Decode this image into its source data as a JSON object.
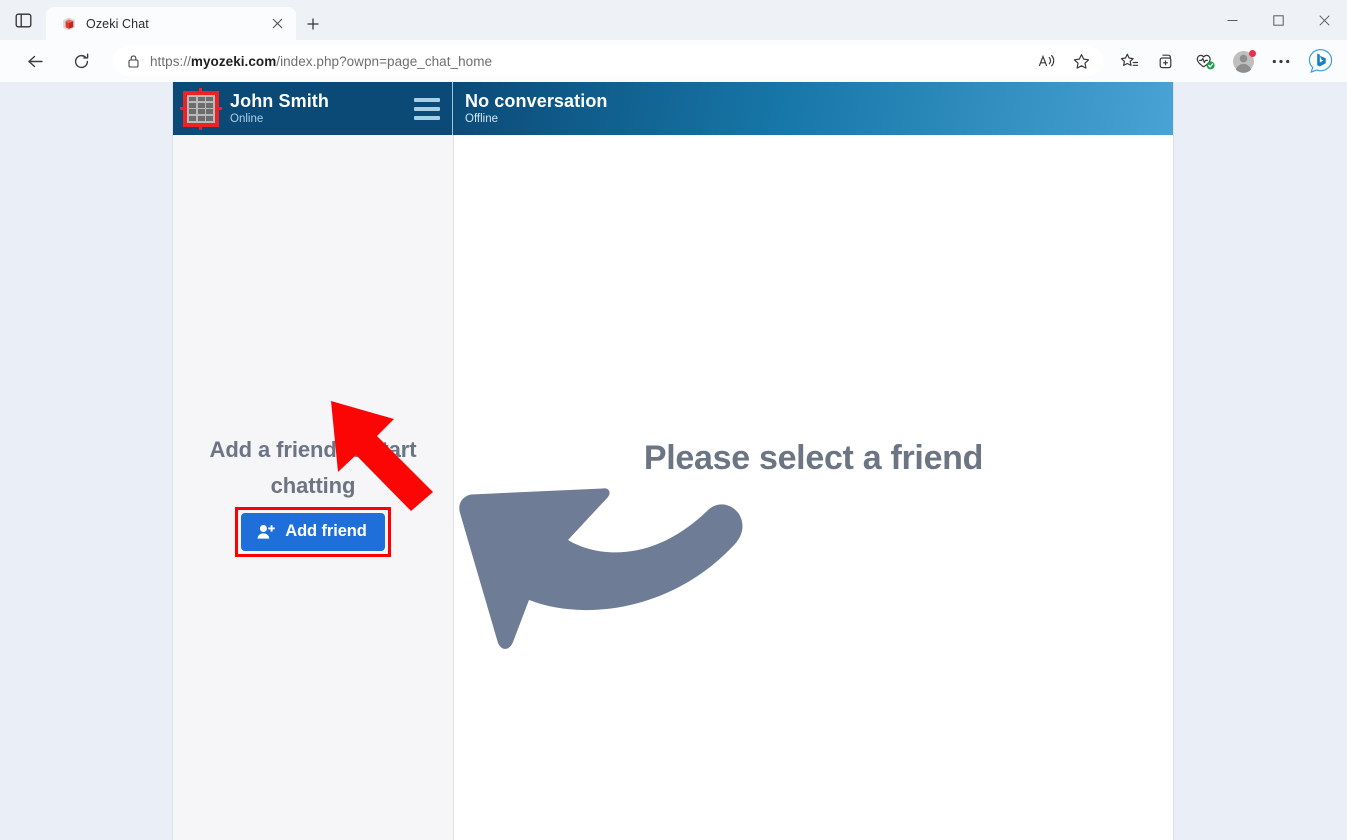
{
  "browser": {
    "tab": {
      "title": "Ozeki Chat",
      "favicon_icon": "red-cube-icon",
      "close_icon": "close-icon"
    },
    "new_tab_icon": "plus-icon",
    "tab_search_icon": "tab-list-icon",
    "window_controls": {
      "minimize_icon": "minimize-icon",
      "maximize_icon": "maximize-icon",
      "close_icon": "window-close-icon"
    },
    "nav": {
      "back_icon": "back-arrow-icon",
      "reload_icon": "reload-icon"
    },
    "address_bar": {
      "lock_icon": "lock-icon",
      "url_scheme": "https://",
      "url_domain": "myozeki.com",
      "url_path": "/index.php?owpn=page_chat_home",
      "read_aloud_icon": "read-aloud-icon",
      "favorite_icon": "star-icon"
    },
    "toolbar_icons": [
      "favorites-icon",
      "collections-icon",
      "browser-essentials-icon",
      "profile-icon",
      "settings-more-icon",
      "copilot-bing-icon"
    ]
  },
  "app": {
    "header": {
      "avatar_icon": "pixel-grid-avatar-icon",
      "user_name": "John Smith",
      "user_status": "Online",
      "menu_icon": "hamburger-menu-icon",
      "conversation_title": "No conversation",
      "conversation_status": "Offline"
    },
    "sidebar": {
      "empty_title": "Add a friend to start chatting",
      "add_friend_label": "Add friend",
      "add_friend_icon": "person-add-icon",
      "highlight_color": "#ff0000",
      "pointer_icon": "red-arrow-up-left-icon"
    },
    "main": {
      "placeholder_title": "Please select a friend",
      "pointer_icon": "gray-curved-arrow-left-icon"
    },
    "colors": {
      "header_dark": "#0b4a77",
      "header_light": "#49a3d4",
      "accent_button": "#1e6fd9",
      "muted_text": "#6c7583",
      "sidebar_bg": "#f6f5f7",
      "page_bg": "#eaeff7"
    }
  }
}
